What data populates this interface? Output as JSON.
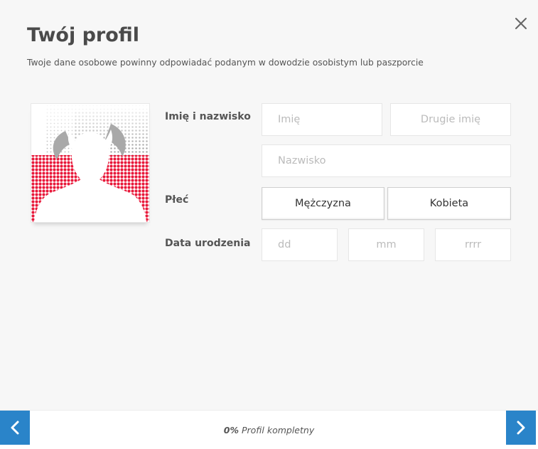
{
  "dialog": {
    "title": "Twój profil",
    "subtitle": "Twoje dane osobowe powinny odpowiadać podanym w dowodzie osobistym lub paszporcie",
    "close_icon": "close-icon"
  },
  "avatar": {
    "icon": "avatar-placeholder-icon",
    "colors": {
      "halftone": "#e8193a",
      "silhouette": "#ffffff"
    }
  },
  "form": {
    "name": {
      "label": "Imię i nazwisko",
      "first_name": {
        "value": "",
        "placeholder": "Imię"
      },
      "middle_name": {
        "value": "",
        "placeholder": "Drugie imię"
      },
      "last_name": {
        "value": "",
        "placeholder": "Nazwisko"
      }
    },
    "gender": {
      "label": "Płeć",
      "options": [
        "Mężczyzna",
        "Kobieta"
      ],
      "selected": null
    },
    "birthdate": {
      "label": "Data urodzenia",
      "day": {
        "value": "",
        "placeholder": "dd"
      },
      "month": {
        "value": "",
        "placeholder": "mm"
      },
      "year": {
        "value": "",
        "placeholder": "rrrr"
      }
    }
  },
  "footer": {
    "progress_value": "0%",
    "progress_label": "Profil kompletny",
    "prev_icon": "chevron-left-icon",
    "next_icon": "chevron-right-icon",
    "accent_color": "#2a84c9"
  }
}
